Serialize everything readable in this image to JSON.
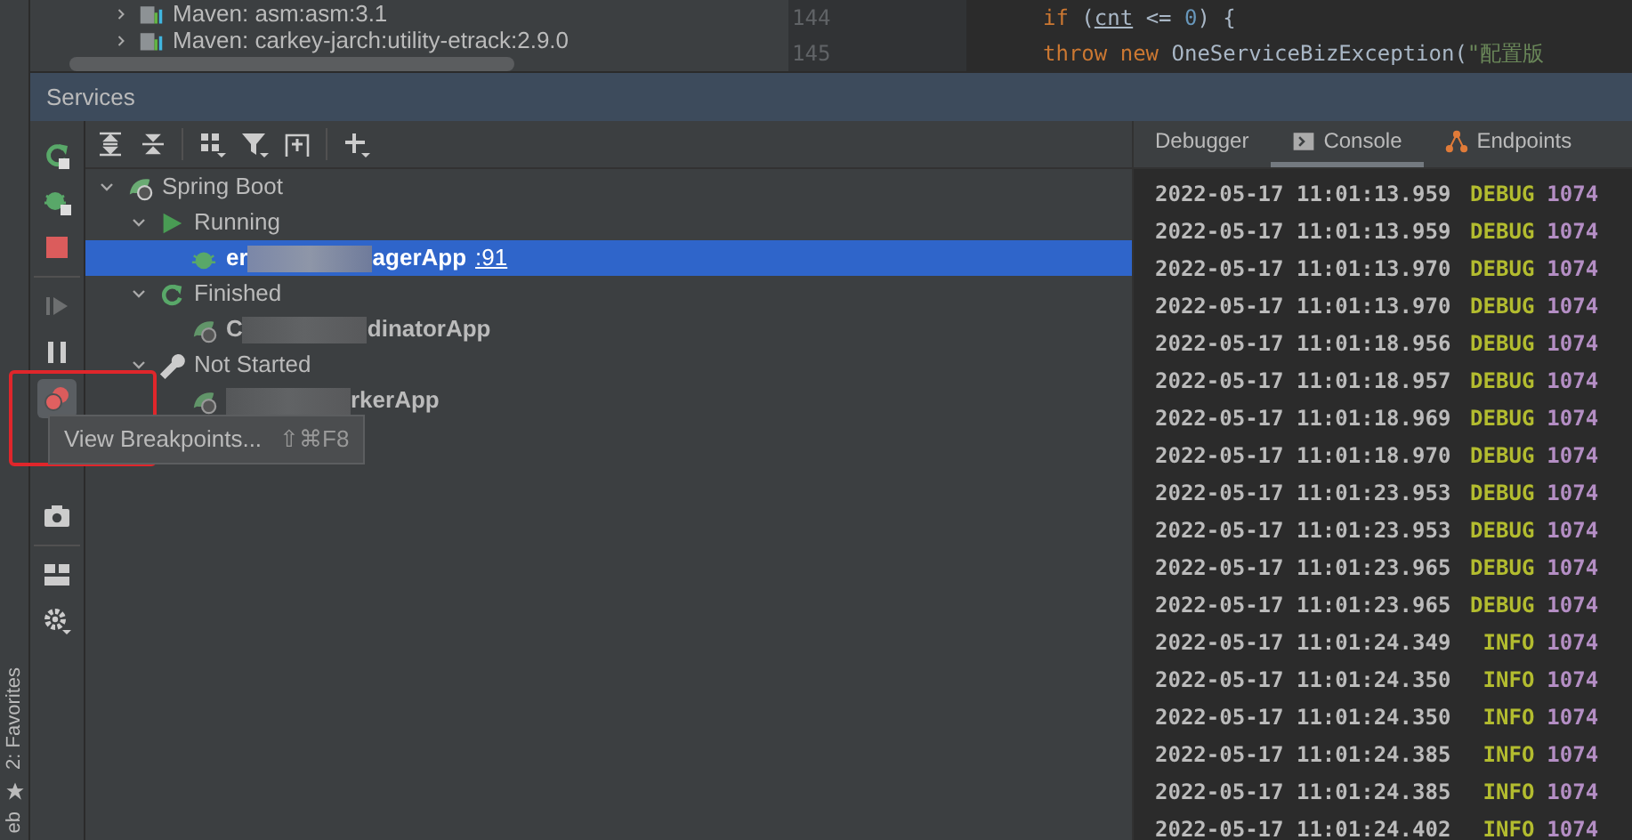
{
  "project_tree": [
    {
      "label": "Maven: asm:asm:3.1",
      "expanded": false
    },
    {
      "label": "Maven: carkey-jarch:utility-etrack:2.9.0",
      "expanded": false
    }
  ],
  "editor": {
    "lines": [
      {
        "number": "144",
        "tokens": [
          {
            "kind": "keyword",
            "text": "if"
          },
          {
            "kind": "plain",
            "text": " ("
          },
          {
            "kind": "var",
            "text": "cnt"
          },
          {
            "kind": "plain",
            "text": " <= "
          },
          {
            "kind": "number",
            "text": "0"
          },
          {
            "kind": "plain",
            "text": ") {"
          }
        ]
      },
      {
        "number": "145",
        "tokens": [
          {
            "kind": "keyword",
            "text": "throw new"
          },
          {
            "kind": "plain",
            "text": " OneServiceBizException("
          },
          {
            "kind": "string",
            "text": "\"配置版"
          }
        ]
      }
    ]
  },
  "panel": {
    "title": "Services"
  },
  "side_stripe": {
    "items": [
      "2: Favorites",
      "eb"
    ]
  },
  "tool_column": [
    {
      "kind": "rerun",
      "disabled": false,
      "selected": false
    },
    {
      "kind": "debug",
      "disabled": false,
      "selected": false
    },
    {
      "kind": "stop",
      "disabled": false,
      "selected": false
    },
    {
      "kind": "separator"
    },
    {
      "kind": "resume",
      "disabled": true,
      "selected": false
    },
    {
      "kind": "pause",
      "disabled": false,
      "selected": false
    },
    {
      "kind": "breakpoints",
      "disabled": false,
      "selected": true
    },
    {
      "kind": "gap"
    },
    {
      "kind": "camera",
      "disabled": false,
      "selected": false
    },
    {
      "kind": "separator"
    },
    {
      "kind": "layout",
      "disabled": false,
      "selected": false
    },
    {
      "kind": "settings",
      "disabled": false,
      "selected": false
    }
  ],
  "toolbar": [
    {
      "kind": "expand-all"
    },
    {
      "kind": "collapse-all"
    },
    {
      "kind": "separator"
    },
    {
      "kind": "group"
    },
    {
      "kind": "filter"
    },
    {
      "kind": "new-tab"
    },
    {
      "kind": "separator"
    },
    {
      "kind": "add"
    }
  ],
  "tree": [
    {
      "label": "Spring Boot",
      "kind": "spring",
      "expanded": true,
      "children": [
        {
          "label": "Running",
          "kind": "running",
          "expanded": true,
          "children": [
            {
              "kind": "app-debug",
              "prefix": "er",
              "suffix": "agerApp",
              "port": ":91",
              "selected": true
            }
          ]
        },
        {
          "label": "Finished",
          "kind": "finished",
          "expanded": true,
          "children": [
            {
              "kind": "app",
              "prefix": "C",
              "suffix": "dinatorApp",
              "selected": false
            }
          ]
        },
        {
          "label": "Not Started",
          "kind": "not-started",
          "expanded": true,
          "children": [
            {
              "kind": "app",
              "suffix": "rkerApp",
              "selected": false
            }
          ]
        }
      ]
    }
  ],
  "tooltip": {
    "text": "View Breakpoints...",
    "shortcut": "⇧⌘F8"
  },
  "console_tabs": [
    {
      "label": "Debugger",
      "kind": "debugger",
      "selected": false
    },
    {
      "label": "Console",
      "kind": "console",
      "selected": true
    },
    {
      "label": "Endpoints",
      "kind": "endpoints",
      "selected": false
    }
  ],
  "log": [
    {
      "time": "2022-05-17 11:01:13.959",
      "level": "DEBUG",
      "pid": "1074"
    },
    {
      "time": "2022-05-17 11:01:13.959",
      "level": "DEBUG",
      "pid": "1074"
    },
    {
      "time": "2022-05-17 11:01:13.970",
      "level": "DEBUG",
      "pid": "1074"
    },
    {
      "time": "2022-05-17 11:01:13.970",
      "level": "DEBUG",
      "pid": "1074"
    },
    {
      "time": "2022-05-17 11:01:18.956",
      "level": "DEBUG",
      "pid": "1074"
    },
    {
      "time": "2022-05-17 11:01:18.957",
      "level": "DEBUG",
      "pid": "1074"
    },
    {
      "time": "2022-05-17 11:01:18.969",
      "level": "DEBUG",
      "pid": "1074"
    },
    {
      "time": "2022-05-17 11:01:18.970",
      "level": "DEBUG",
      "pid": "1074"
    },
    {
      "time": "2022-05-17 11:01:23.953",
      "level": "DEBUG",
      "pid": "1074"
    },
    {
      "time": "2022-05-17 11:01:23.953",
      "level": "DEBUG",
      "pid": "1074"
    },
    {
      "time": "2022-05-17 11:01:23.965",
      "level": "DEBUG",
      "pid": "1074"
    },
    {
      "time": "2022-05-17 11:01:23.965",
      "level": "DEBUG",
      "pid": "1074"
    },
    {
      "time": "2022-05-17 11:01:24.349",
      "level": "INFO",
      "pid": "1074"
    },
    {
      "time": "2022-05-17 11:01:24.350",
      "level": "INFO",
      "pid": "1074"
    },
    {
      "time": "2022-05-17 11:01:24.350",
      "level": "INFO",
      "pid": "1074"
    },
    {
      "time": "2022-05-17 11:01:24.385",
      "level": "INFO",
      "pid": "1074"
    },
    {
      "time": "2022-05-17 11:01:24.385",
      "level": "INFO",
      "pid": "1074"
    },
    {
      "time": "2022-05-17 11:01:24.402",
      "level": "INFO",
      "pid": "1074"
    }
  ]
}
